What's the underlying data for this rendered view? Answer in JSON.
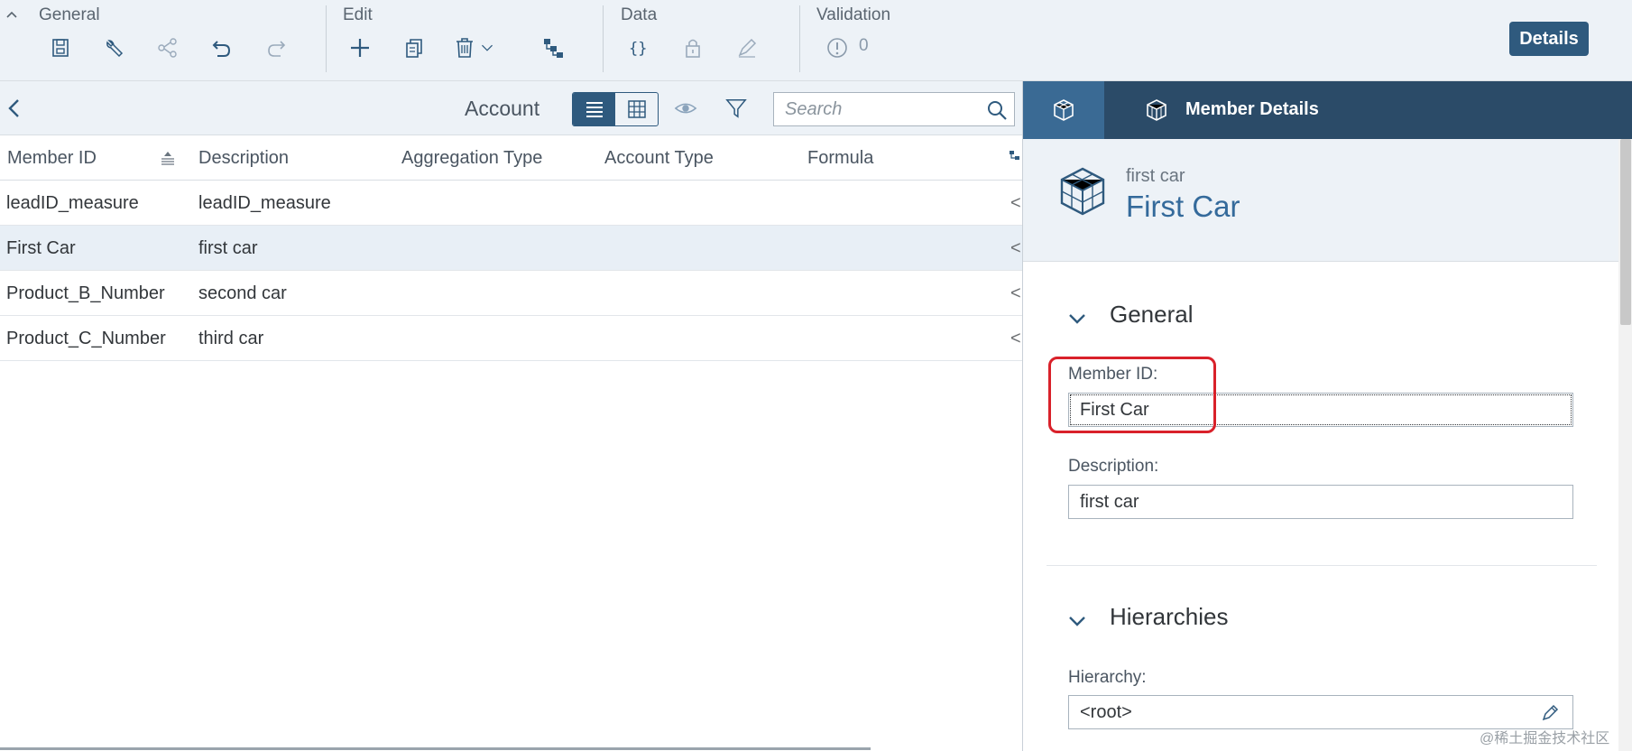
{
  "toolbar": {
    "groups": {
      "general": "General",
      "edit": "Edit",
      "data": "Data",
      "validation": "Validation"
    },
    "validation_count": "0",
    "details_button": "Details",
    "icons": [
      "save-icon",
      "wrench-icon",
      "share-icon",
      "undo-icon",
      "redo-icon",
      "add-icon",
      "copy-icon",
      "delete-icon",
      "chevron-down-icon",
      "hierarchy-icon",
      "formula-braces-icon",
      "lock-icon",
      "edit-pen-icon",
      "warning-circle-icon"
    ]
  },
  "subbar": {
    "dimension_label": "Account",
    "search_placeholder": "Search"
  },
  "grid": {
    "columns": [
      "Member ID",
      "Description",
      "Aggregation Type",
      "Account Type",
      "Formula"
    ],
    "rows": [
      {
        "member_id": "leadID_measure",
        "description": "leadID_measure",
        "trunc": "<"
      },
      {
        "member_id": "First Car",
        "description": "first car",
        "trunc": "<"
      },
      {
        "member_id": "Product_B_Number",
        "description": "second car",
        "trunc": "<"
      },
      {
        "member_id": "Product_C_Number",
        "description": "third car",
        "trunc": "<"
      }
    ],
    "selected_row": 1
  },
  "details_panel": {
    "title": "Member Details",
    "object_subtitle": "first car",
    "object_title": "First Car",
    "sections": {
      "general": "General",
      "hierarchies": "Hierarchies"
    },
    "fields": {
      "member_id_label": "Member ID:",
      "member_id_value": "First Car",
      "description_label": "Description:",
      "description_value": "first car",
      "hierarchy_label": "Hierarchy:",
      "hierarchy_value": "<root>"
    }
  },
  "watermark": "@稀土掘金技术社区",
  "colors": {
    "accent": "#2f5a7e",
    "panel_header": "#2b4b68",
    "highlight": "#d9212a",
    "object_title": "#346a9b"
  }
}
